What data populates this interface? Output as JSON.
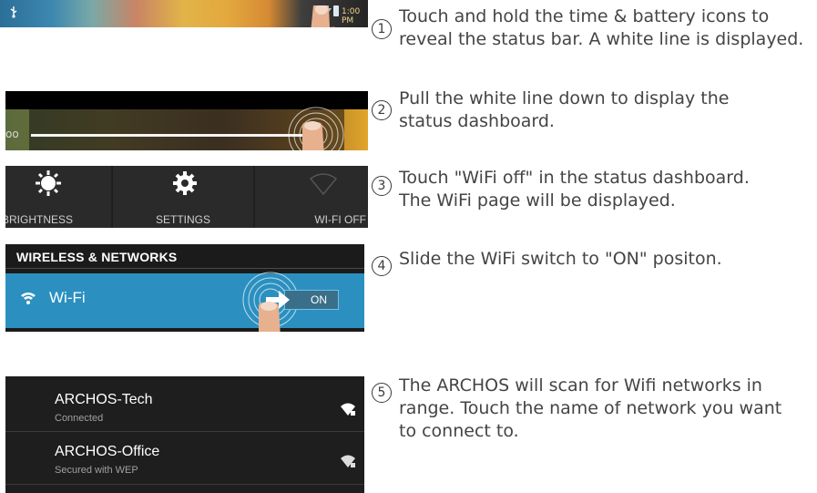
{
  "steps": [
    {
      "num": "1",
      "lines": [
        "Touch and hold the time & battery icons to",
        "reveal the status bar. A white line is displayed."
      ]
    },
    {
      "num": "2",
      "lines": [
        "Pull the white line down to display the",
        "status dashboard."
      ]
    },
    {
      "num": "3",
      "lines": [
        "Touch \"WiFi off\" in the status dashboard.",
        "The WiFi page will be displayed."
      ]
    },
    {
      "num": "4",
      "lines": [
        "Slide the WiFi switch to \"ON\" positon."
      ]
    },
    {
      "num": "5",
      "lines": [
        "The ARCHOS will scan for Wifi networks in",
        "range. Touch the name of network you want",
        "to connect to."
      ]
    }
  ],
  "status_bar": {
    "time": "1:00 PM",
    "fragment": "oo"
  },
  "dashboard": {
    "brightness": "BRIGHTNESS",
    "settings": "SETTINGS",
    "wifi_off": "WI-FI OFF"
  },
  "wireless": {
    "header": "WIRELESS & NETWORKS",
    "wifi_label": "Wi-Fi",
    "switch_label": "ON"
  },
  "networks": [
    {
      "name": "ARCHOS-Tech",
      "status": "Connected"
    },
    {
      "name": "ARCHOS-Office",
      "status": "Secured with WEP"
    }
  ],
  "colors": {
    "accent": "#2b90c0",
    "text": "#444444"
  },
  "icons": [
    "usb-icon",
    "signal-icon",
    "battery-icon",
    "finger-icon",
    "brightness-icon",
    "settings-icon",
    "wifi-icon",
    "arrow-right-icon",
    "wifi-lock-icon"
  ]
}
